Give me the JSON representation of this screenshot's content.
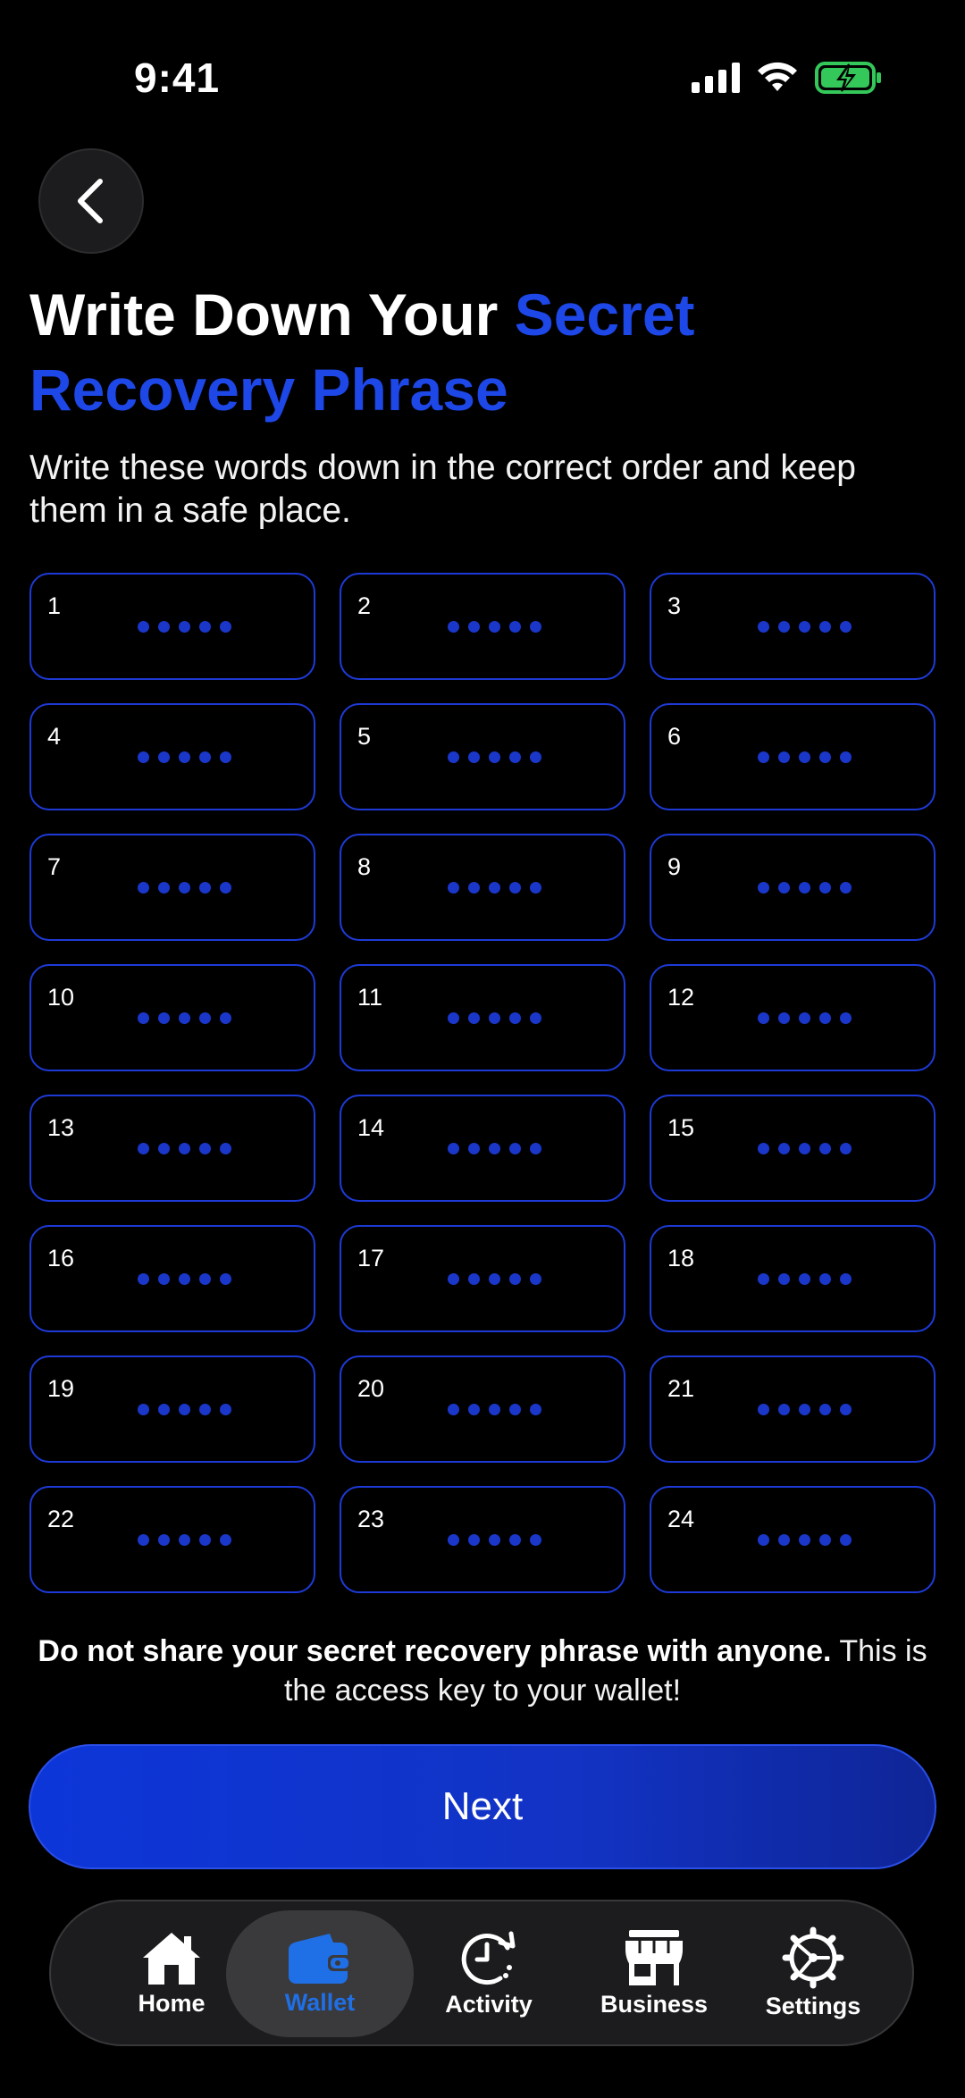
{
  "status_bar": {
    "time": "9:41"
  },
  "header": {
    "title_part1": "Write Down Your ",
    "title_part2": "Secret Recovery Phrase",
    "subtitle": "Write these words down in the correct order and keep them in a safe place."
  },
  "words": [
    {
      "num": "1"
    },
    {
      "num": "2"
    },
    {
      "num": "3"
    },
    {
      "num": "4"
    },
    {
      "num": "5"
    },
    {
      "num": "6"
    },
    {
      "num": "7"
    },
    {
      "num": "8"
    },
    {
      "num": "9"
    },
    {
      "num": "10"
    },
    {
      "num": "11"
    },
    {
      "num": "12"
    },
    {
      "num": "13"
    },
    {
      "num": "14"
    },
    {
      "num": "15"
    },
    {
      "num": "16"
    },
    {
      "num": "17"
    },
    {
      "num": "18"
    },
    {
      "num": "19"
    },
    {
      "num": "20"
    },
    {
      "num": "21"
    },
    {
      "num": "22"
    },
    {
      "num": "23"
    },
    {
      "num": "24"
    }
  ],
  "warning": {
    "bold": "Do not share your secret recovery phrase with anyone.",
    "rest": " This is the access key to your wallet!"
  },
  "next_button": {
    "label": "Next"
  },
  "tab_bar": {
    "tabs": [
      {
        "label": "Home",
        "icon": "home-icon"
      },
      {
        "label": "Wallet",
        "icon": "wallet-icon",
        "active": true
      },
      {
        "label": "Activity",
        "icon": "activity-icon"
      },
      {
        "label": "Business",
        "icon": "store-icon"
      },
      {
        "label": "Settings",
        "icon": "gear-icon"
      }
    ]
  },
  "colors": {
    "accent": "#1d47e6",
    "active_tab": "#1f6fe6",
    "battery": "#34c759"
  }
}
